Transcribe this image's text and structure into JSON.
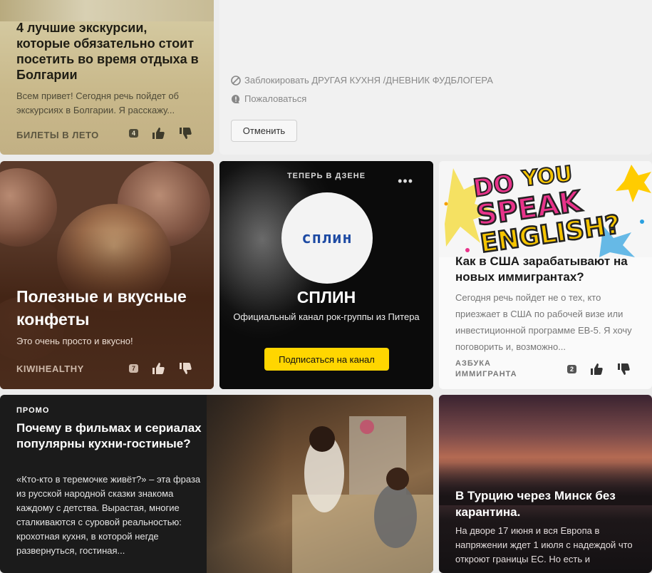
{
  "cards": {
    "bulgaria": {
      "title": "4 лучшие экскурсии, которые обязательно стоит посетить во время отдыха в Болгарии",
      "description": "Всем привет! Сегодня речь пойдет об экскурсиях в Болгарии. Я расскажу...",
      "source": "БИЛЕТЫ В ЛЕТО",
      "comments": "4"
    },
    "blocked": {
      "block_label": "Заблокировать ДРУГАЯ КУХНЯ /ДНЕВНИК ФУДБЛОГЕРА",
      "report_label": "Пожаловаться",
      "cancel_label": "Отменить"
    },
    "candies": {
      "title": "Полезные и вкусные конфеты",
      "description": "Это очень просто и вкусно!",
      "source": "KIWIHEALTHY",
      "comments": "7"
    },
    "splin": {
      "eyebrow": "ТЕПЕРЬ В ДЗЕНЕ",
      "more": "•••",
      "logo_text": "сплин",
      "name": "СПЛИН",
      "subtitle": "Официальный канал рок-группы из Питера",
      "subscribe_label": "Подписаться на канал"
    },
    "english": {
      "title": "Как в США зарабатывают на новых иммигрантах?",
      "description": "Сегодня речь пойдет не о тех, кто приезжает в США по рабочей визе или инвестиционной программе ЕВ-5. Я хочу поговорить и, возможно...",
      "source": "АЗБУКА ИММИГРАНТА",
      "comments": "2",
      "art_words": [
        "DO",
        "YOU",
        "SPEAK",
        "ENGLISH?"
      ]
    },
    "friends": {
      "promo": "ПРОМО",
      "title": "Почему в фильмах и сериалах популярны кухни-гостиные?",
      "description": "«Кто-кто в теремочке живёт?» – эта фраза из русской народной сказки знакома каждому с детства. Вырастая, многие сталкиваются с суровой реальностью: крохотная кухня, в которой негде развернуться, гостиная..."
    },
    "turkey": {
      "title": "В Турцию через Минск без карантина.",
      "description": "На дворе 17 июня и вся Европа в напряжении ждет 1 июля с надеждой что откроют границы ЕС. Но есть и"
    }
  },
  "colors": {
    "accent_yellow": "#ffd600",
    "logo_blue": "#1d4aa3"
  }
}
